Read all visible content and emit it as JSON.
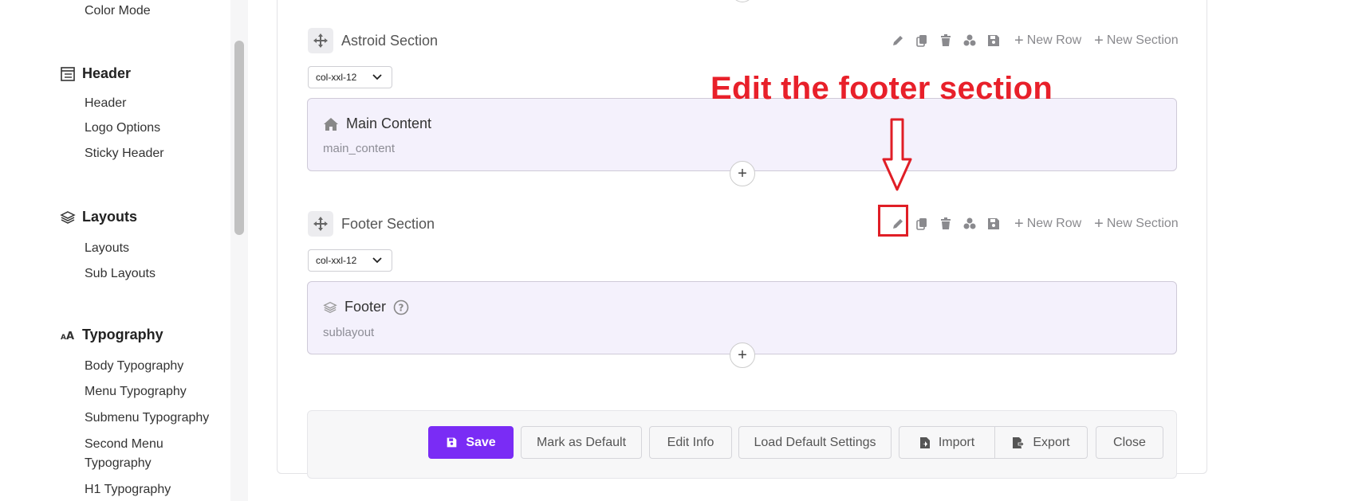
{
  "sidebar": {
    "color_mode": "Color Mode",
    "header_group": "Header",
    "header_items": [
      "Header",
      "Logo Options",
      "Sticky Header"
    ],
    "layouts_group": "Layouts",
    "layouts_items": [
      "Layouts",
      "Sub Layouts"
    ],
    "typography_group": "Typography",
    "typography_items": [
      "Body Typography",
      "Menu Typography",
      "Submenu Typography",
      "Second Menu",
      "Typography",
      "H1 Typography"
    ]
  },
  "tools": {
    "new_row": "New Row",
    "new_section": "New Section"
  },
  "sections": [
    {
      "title": "Astroid Section",
      "col": "col-xxl-12",
      "row_title": "Main Content",
      "row_sub": "main_content"
    },
    {
      "title": "Footer Section",
      "col": "col-xxl-12",
      "row_title": "Footer",
      "row_sub": "sublayout"
    }
  ],
  "annotation": "Edit the footer section",
  "footer": {
    "save": "Save",
    "mark_default": "Mark as Default",
    "edit_info": "Edit Info",
    "load_default": "Load Default Settings",
    "import": "Import",
    "export": "Export",
    "close": "Close"
  },
  "colors": {
    "accent": "#7a2cf5",
    "annotation": "#e8202a"
  }
}
